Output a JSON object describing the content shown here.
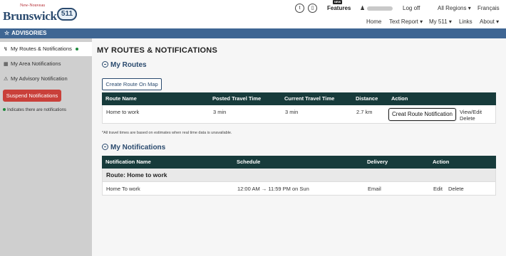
{
  "header": {
    "logo": {
      "small_text": "New-Nouveau",
      "main_text": "Brunswick",
      "badge": "511"
    },
    "icons": {
      "twitter": "twitter-icon",
      "mobile": "mobile-icon"
    },
    "new_badge": "NEW",
    "features_label": "Features",
    "user_icon": "user-icon",
    "logoff_label": "Log off",
    "regions_label": "All Regions ▾",
    "language_label": "Français"
  },
  "nav": {
    "home": "Home",
    "text_report": "Text Report ▾",
    "my511": "My 511 ▾",
    "links": "Links",
    "about": "About ▾"
  },
  "advisories_bar": {
    "label": "ADVISORIES"
  },
  "sidebar": {
    "items": [
      {
        "label": "My Routes & Notifications",
        "icon": "route-icon"
      },
      {
        "label": "My Area Notifications",
        "icon": "map-icon"
      },
      {
        "label": "My Advisory Notification",
        "icon": "warning-icon"
      }
    ],
    "suspend_label": "Suspend Notifications",
    "note": "Indicates there are notifications"
  },
  "main": {
    "title": "MY ROUTES & NOTIFICATIONS",
    "routes_section": "My Routes",
    "create_button": "Create Route On Map",
    "routes_table": {
      "headers": [
        "Route Name",
        "Posted Travel Time",
        "Current Travel Time",
        "Distance",
        "Action"
      ],
      "rows": [
        {
          "name": "Home to work",
          "posted": "3 min",
          "current": "3 min",
          "distance": "2.7 km",
          "view_edit": "View/Edit",
          "delete": "Delete"
        }
      ],
      "tooltip": "Creat Route Notification"
    },
    "footnote": "*All travel times are based on estimates when real time data is unavailable.",
    "notifications_section": "My Notifications",
    "notifications_table": {
      "headers": [
        "Notification Name",
        "Schedule",
        "Delivery",
        "Action"
      ],
      "group_label": "Route: Home to work",
      "rows": [
        {
          "name": "Home To work",
          "schedule": "12:00 AM → 11:59 PM on Sun",
          "delivery": "Email",
          "edit": "Edit",
          "delete": "Delete"
        }
      ]
    }
  },
  "colors": {
    "header_bar": "#3f6693",
    "table_header": "#173b3b",
    "suspend": "#c9403a",
    "accent": "#2a4a6e"
  }
}
